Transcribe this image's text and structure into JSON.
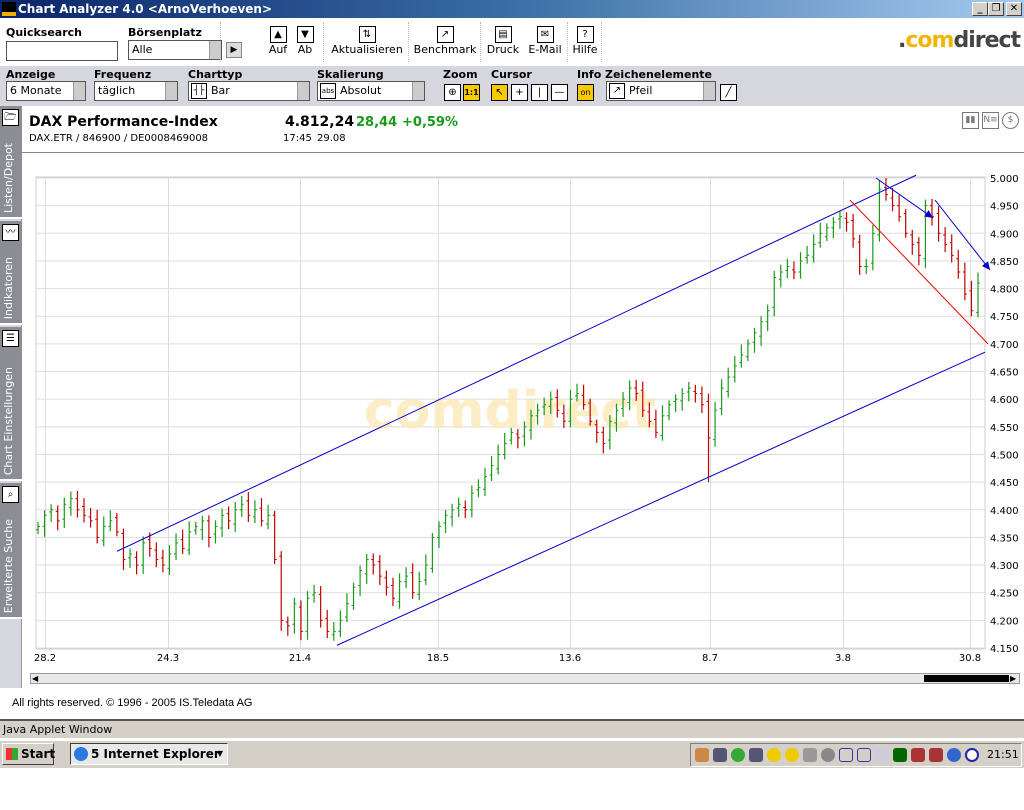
{
  "window": {
    "title": "Chart Analyzer 4.0  <ArnoVerhoeven>",
    "min": "_",
    "restore": "❐",
    "close": "✕"
  },
  "toolbar": {
    "quicksearch_label": "Quicksearch",
    "quicksearch_value": "",
    "boersenplatz_label": "Börsenplatz",
    "boersenplatz_value": "Alle",
    "buttons": [
      {
        "label": "Auf",
        "icon": "▲"
      },
      {
        "label": "Ab",
        "icon": "▼"
      },
      {
        "label": "Aktualisieren",
        "icon": "⇅"
      },
      {
        "label": "Benchmark",
        "icon": "↗"
      },
      {
        "label": "Druck",
        "icon": "▤"
      },
      {
        "label": "E-Mail",
        "icon": "✉"
      },
      {
        "label": "Hilfe",
        "icon": "?"
      }
    ],
    "brand_dot": ".",
    "brand_com": "com",
    "brand_direct": "direct"
  },
  "settings": {
    "anzeige_label": "Anzeige",
    "anzeige_value": "6 Monate",
    "frequenz_label": "Frequenz",
    "frequenz_value": "täglich",
    "charttyp_label": "Charttyp",
    "charttyp_value": "Bar",
    "skalierung_label": "Skalierung",
    "skalierung_value": "Absolut",
    "skalierung_icon": "abs",
    "zoom_label": "Zoom",
    "zoom_reset": "1:1",
    "cursor_label": "Cursor",
    "info_label": "Info",
    "info_value": "on",
    "zeichen_label": "Zeichenelemente",
    "zeichen_value": "Pfeil"
  },
  "sidebar": [
    {
      "label": "Listen/Depot",
      "icon": "folder-icon"
    },
    {
      "label": "Indikatoren",
      "icon": "indicator-icon"
    },
    {
      "label": "Chart Einstellungen",
      "icon": "list-icon"
    },
    {
      "label": "Erweiterte Suche",
      "icon": "search-icon"
    }
  ],
  "instrument": {
    "name": "DAX Performance-Index",
    "ids": "DAX.ETR  /  846900  /  DE0008469008",
    "price": "4.812,24",
    "change": "28,44",
    "change_pct": "+0,59%",
    "time": "17:45",
    "date": "29.08"
  },
  "chart_data": {
    "type": "bar",
    "x_ticks": [
      "28.2",
      "24.3",
      "21.4",
      "18.5",
      "13.6",
      "8.7",
      "3.8",
      "30.8"
    ],
    "y_ticks": [
      "5.000",
      "4.950",
      "4.900",
      "4.850",
      "4.800",
      "4.750",
      "4.700",
      "4.650",
      "4.600",
      "4.550",
      "4.500",
      "4.450",
      "4.400",
      "4.350",
      "4.300",
      "4.250",
      "4.200",
      "4.150"
    ],
    "ylim": [
      4150,
      5000
    ],
    "watermark": "comdirect",
    "colors": {
      "up": "#1a9a1a",
      "down": "#c00000",
      "channel": "#0000cc",
      "trend": "#ff0000"
    },
    "closes": [
      4370,
      4390,
      4400,
      4380,
      4410,
      4420,
      4400,
      4390,
      4380,
      4350,
      4370,
      4380,
      4360,
      4310,
      4320,
      4300,
      4340,
      4330,
      4310,
      4300,
      4320,
      4340,
      4330,
      4360,
      4370,
      4380,
      4350,
      4370,
      4390,
      4380,
      4400,
      4410,
      4390,
      4400,
      4380,
      4390,
      4310,
      4200,
      4190,
      4230,
      4180,
      4240,
      4250,
      4200,
      4180,
      4180,
      4200,
      4230,
      4260,
      4290,
      4310,
      4300,
      4280,
      4260,
      4240,
      4270,
      4280,
      4250,
      4270,
      4300,
      4350,
      4370,
      4390,
      4400,
      4410,
      4400,
      4430,
      4440,
      4460,
      4480,
      4500,
      4520,
      4540,
      4530,
      4550,
      4570,
      4580,
      4590,
      4600,
      4580,
      4560,
      4600,
      4610,
      4590,
      4560,
      4540,
      4520,
      4560,
      4580,
      4600,
      4620,
      4610,
      4580,
      4560,
      4540,
      4570,
      4590,
      4600,
      4610,
      4620,
      4610,
      4590,
      4530,
      4580,
      4620,
      4640,
      4660,
      4680,
      4700,
      4720,
      4740,
      4760,
      4820,
      4830,
      4840,
      4830,
      4850,
      4860,
      4880,
      4900,
      4910,
      4920,
      4930,
      4920,
      4890,
      4840,
      4840,
      4900,
      4980,
      4970,
      4950,
      4930,
      4900,
      4880,
      4860,
      4950,
      4930,
      4900,
      4880,
      4860,
      4830,
      4790,
      4760,
      4810
    ]
  },
  "footer": {
    "copyright": "All rights reserved. © 1996 - 2005 IS.Teledata AG",
    "status": "Java Applet Window"
  },
  "taskbar": {
    "start": "Start",
    "task": "5 Internet Explorer",
    "clock": "21:51"
  }
}
